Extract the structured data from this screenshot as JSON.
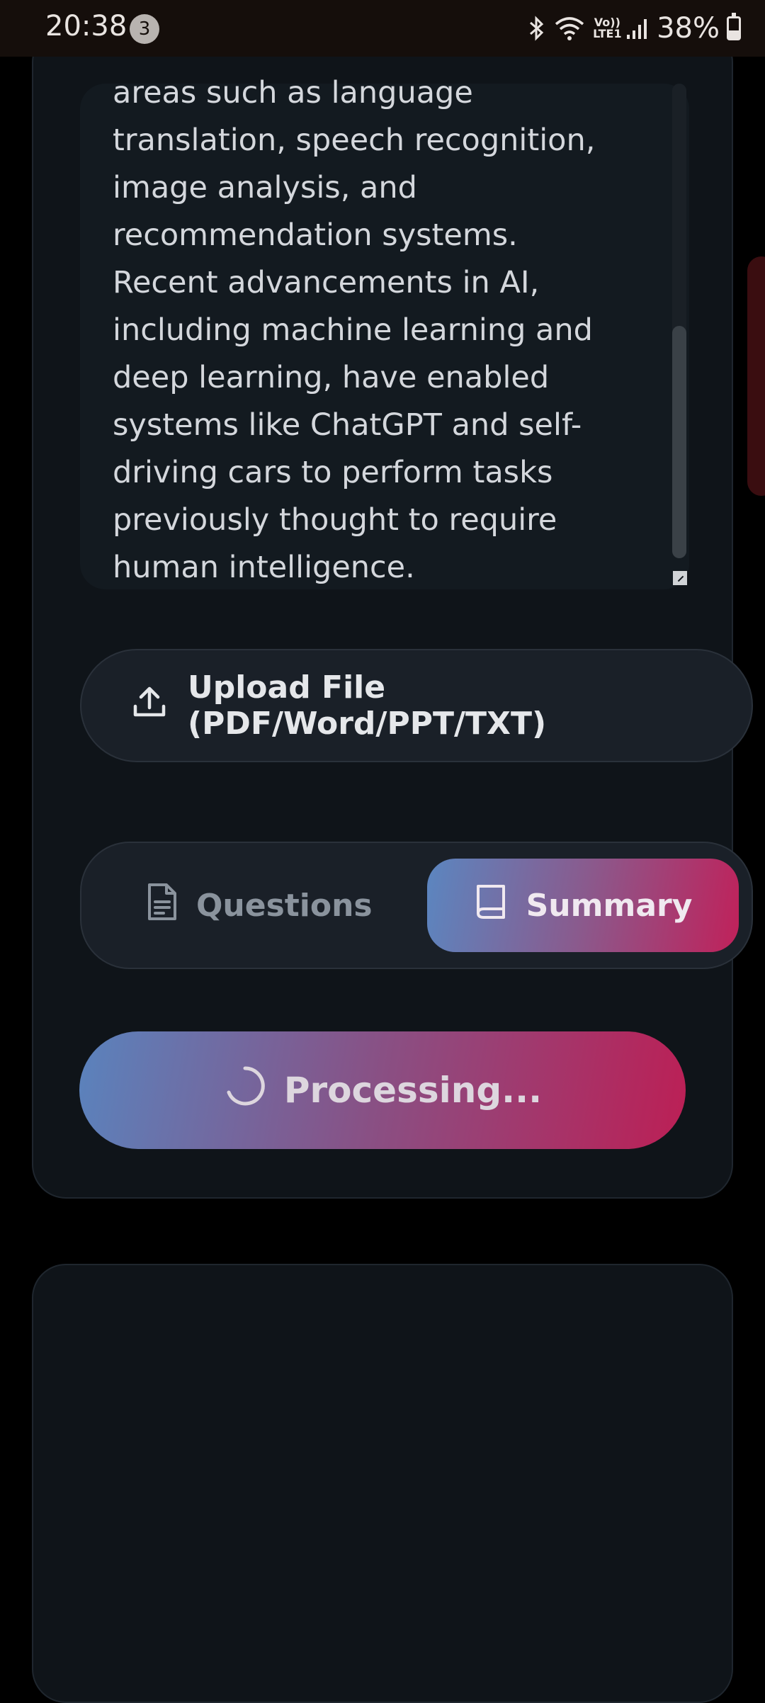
{
  "status_bar": {
    "time": "20:38",
    "notification_count": "3",
    "network_label": "Vo)) LTE1",
    "battery": "38%",
    "battery_level": 0.38,
    "icons": [
      "bluetooth-icon",
      "wifi-icon",
      "signal-icon",
      "battery-icon"
    ]
  },
  "input": {
    "text": "areas such as language\ntranslation, speech recognition,\nimage analysis, and\nrecommendation systems.\nRecent advancements in AI,\nincluding machine learning and\ndeep learning, have enabled\nsystems like ChatGPT and self-\ndriving cars to perform tasks\npreviously thought to require\nhuman intelligence."
  },
  "upload": {
    "label": "Upload File (PDF/Word/PPT/TXT)",
    "icon": "upload-icon"
  },
  "mode_toggle": {
    "questions_label": "Questions",
    "summary_label": "Summary",
    "selected": "Summary"
  },
  "action": {
    "label": "Processing...",
    "icon": "spinner-icon"
  },
  "colors": {
    "background": "#000000",
    "card": "#0f1419",
    "gradient_start": "#5a83bd",
    "gradient_end": "#bc1f55"
  }
}
